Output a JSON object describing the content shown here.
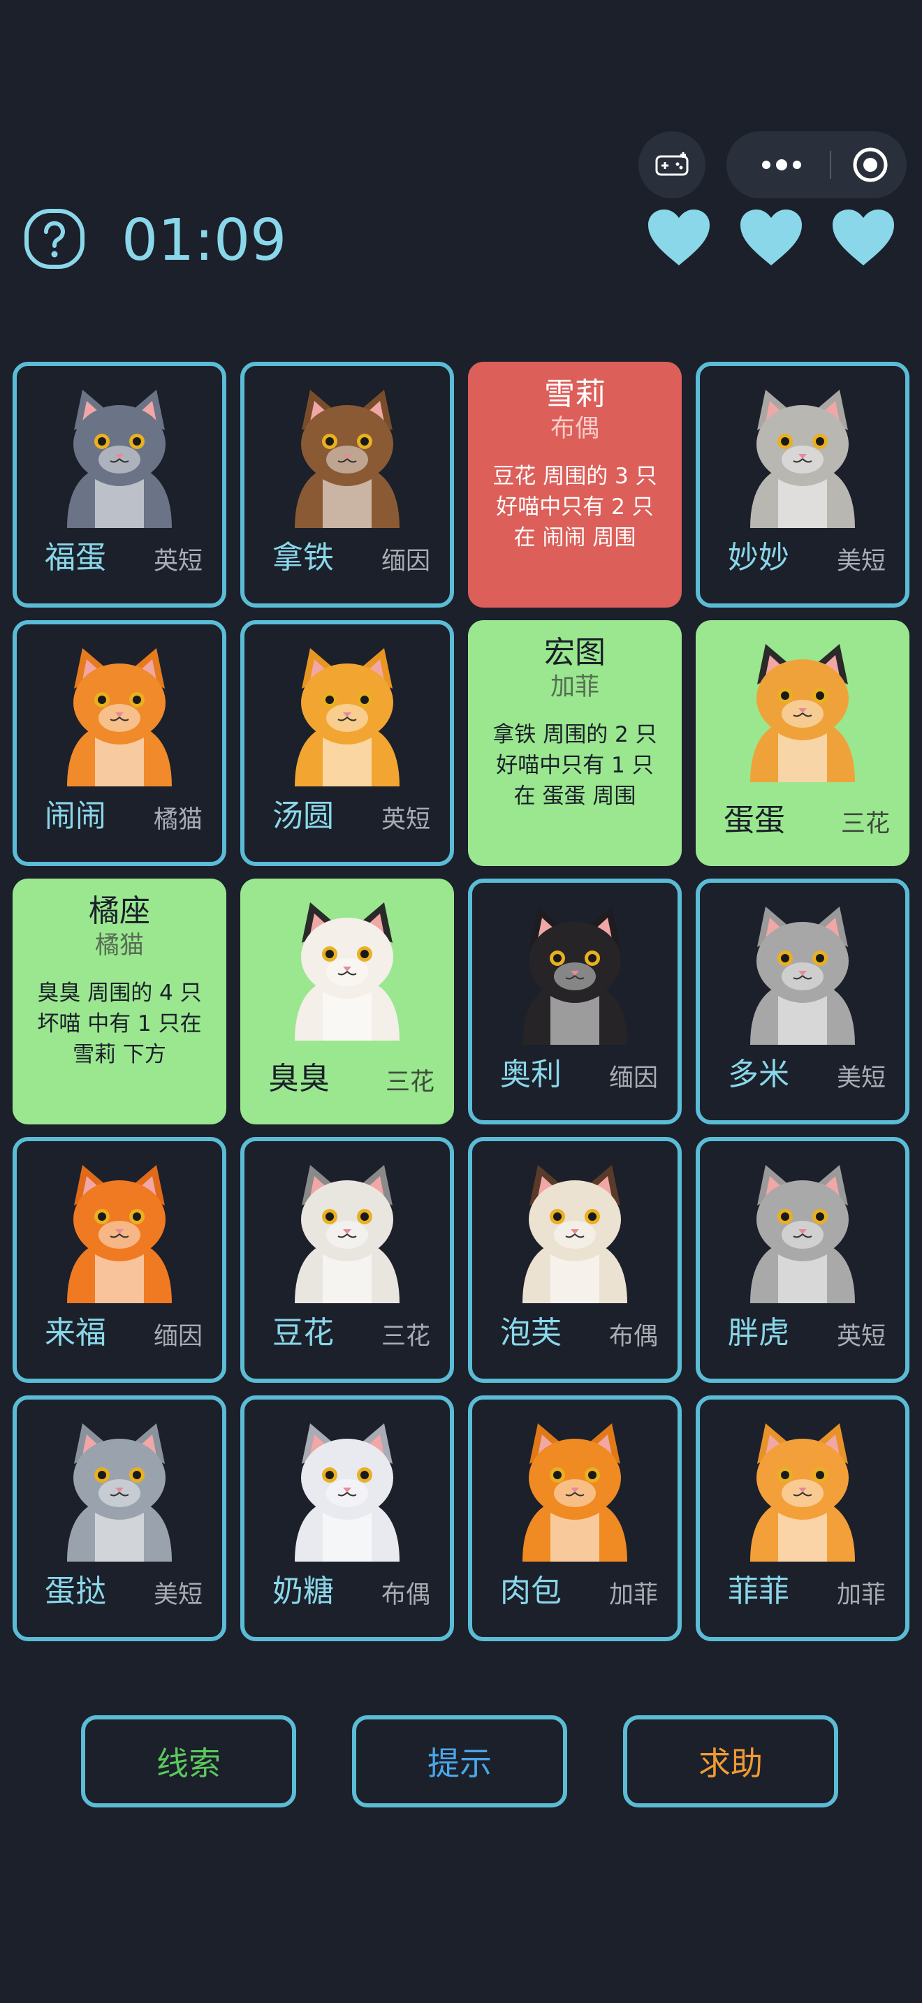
{
  "header": {
    "timer": "01:09",
    "lives": 3
  },
  "colors": {
    "accent": "#8ad7ea",
    "border": "#5bbcd6",
    "solved": "#9ae78f",
    "alert": "#dc5f5a"
  },
  "cards": [
    {
      "type": "cat",
      "name": "福蛋",
      "breed": "英短",
      "state": "normal",
      "fur": "#6b7486",
      "ear": "#6b7486"
    },
    {
      "type": "cat",
      "name": "拿铁",
      "breed": "缅因",
      "state": "normal",
      "fur": "#8a5a34",
      "ear": "#7a4d2a"
    },
    {
      "type": "clue",
      "name": "雪莉",
      "breed": "布偶",
      "text": "豆花 周围的 3 只 好喵中只有 2 只 在 闹闹 周围",
      "color": "red"
    },
    {
      "type": "cat",
      "name": "妙妙",
      "breed": "美短",
      "state": "normal",
      "fur": "#b9b7b2",
      "ear": "#a9a7a2"
    },
    {
      "type": "cat",
      "name": "闹闹",
      "breed": "橘猫",
      "state": "normal",
      "fur": "#f08a2a",
      "ear": "#e57a1e"
    },
    {
      "type": "cat",
      "name": "汤圆",
      "breed": "英短",
      "state": "normal",
      "fur": "#f2a531",
      "ear": "#e99522"
    },
    {
      "type": "clue",
      "name": "宏图",
      "breed": "加菲",
      "text": "拿铁 周围的 2 只 好喵中只有 1 只 在 蛋蛋 周围",
      "color": "green"
    },
    {
      "type": "cat",
      "name": "蛋蛋",
      "breed": "三花",
      "state": "solved",
      "fur": "#f0a23a",
      "ear": "#2a2a2a"
    },
    {
      "type": "clue",
      "name": "橘座",
      "breed": "橘猫",
      "text": "臭臭 周围的 4 只 坏喵 中有 1 只在 雪莉 下方",
      "color": "green"
    },
    {
      "type": "cat",
      "name": "臭臭",
      "breed": "三花",
      "state": "solved",
      "fur": "#f4efe8",
      "ear": "#2a2a2a"
    },
    {
      "type": "cat",
      "name": "奥利",
      "breed": "缅因",
      "state": "normal",
      "fur": "#262426",
      "ear": "#1e1c1e"
    },
    {
      "type": "cat",
      "name": "多米",
      "breed": "美短",
      "state": "normal",
      "fur": "#a7a7a7",
      "ear": "#9a9a9a"
    },
    {
      "type": "cat",
      "name": "来福",
      "breed": "缅因",
      "state": "normal",
      "fur": "#f07a22",
      "ear": "#e06a18"
    },
    {
      "type": "cat",
      "name": "豆花",
      "breed": "三花",
      "state": "normal",
      "fur": "#e9e6e0",
      "ear": "#8a8a8a"
    },
    {
      "type": "cat",
      "name": "泡芙",
      "breed": "布偶",
      "state": "normal",
      "fur": "#ece2d2",
      "ear": "#5a3a28"
    },
    {
      "type": "cat",
      "name": "胖虎",
      "breed": "英短",
      "state": "normal",
      "fur": "#a9a9a9",
      "ear": "#9a9a9a"
    },
    {
      "type": "cat",
      "name": "蛋挞",
      "breed": "美短",
      "state": "normal",
      "fur": "#9aa3ad",
      "ear": "#8a939d"
    },
    {
      "type": "cat",
      "name": "奶糖",
      "breed": "布偶",
      "state": "normal",
      "fur": "#e9eaf0",
      "ear": "#a9abb5"
    },
    {
      "type": "cat",
      "name": "肉包",
      "breed": "加菲",
      "state": "normal",
      "fur": "#f08a22",
      "ear": "#e07a16"
    },
    {
      "type": "cat",
      "name": "菲菲",
      "breed": "加菲",
      "state": "normal",
      "fur": "#f4a03a",
      "ear": "#e8922a"
    }
  ],
  "buttons": {
    "clues": "线索",
    "hint": "提示",
    "help": "求助"
  }
}
